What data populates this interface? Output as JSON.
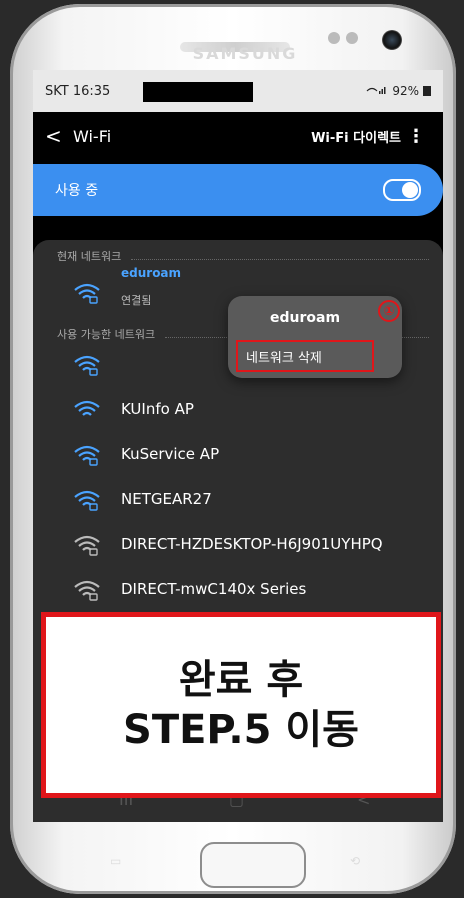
{
  "device": {
    "brand": "SAMSUNG"
  },
  "status_bar": {
    "carrier_time": "SKT 16:35",
    "signal_battery": "92%"
  },
  "app_bar": {
    "back_icon": "chevron-left-icon",
    "title": "Wi-Fi",
    "direct_label": "Wi-Fi 다이렉트",
    "more_icon": "more-vert-icon"
  },
  "wifi_toggle": {
    "label": "사용 중",
    "state": "on"
  },
  "current_network": {
    "section_label": "현재 네트워크",
    "name": "eduroam",
    "status": "연결됨"
  },
  "available": {
    "section_label": "사용 가능한 네트워크",
    "networks": [
      {
        "name": ""
      },
      {
        "name": "KUInfo AP"
      },
      {
        "name": "KuService AP"
      },
      {
        "name": "NETGEAR27"
      },
      {
        "name": "DIRECT-HZDESKTOP-H6J901UYHPQ"
      },
      {
        "name": "DIRECT-mwC140x Series"
      }
    ]
  },
  "popup": {
    "title": "eduroam",
    "delete_label": "네트워크 삭제",
    "step_marker": "①"
  },
  "callout": {
    "line1": "완료 후",
    "line2": "STEP.5 이동"
  },
  "colors": {
    "accent_blue": "#3b8ff0",
    "highlight_red": "#e0161a",
    "connected_blue": "#4aa3ff"
  }
}
